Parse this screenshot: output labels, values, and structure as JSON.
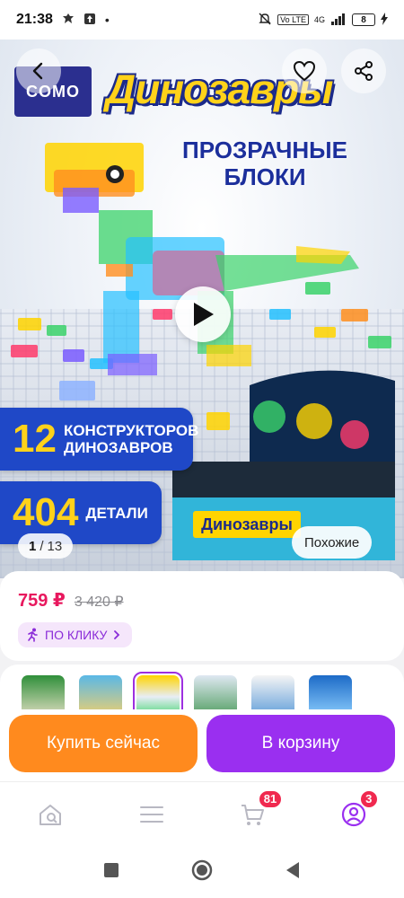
{
  "status_bar": {
    "time": "21:38",
    "network": "4G",
    "volte": "Vo LTE",
    "battery": "8"
  },
  "hero": {
    "brand_logo": "COMO",
    "title": "Динозавры",
    "subtitle_line1": "ПРОЗРАЧНЫЕ",
    "subtitle_line2": "БЛОКИ",
    "badge1_number": "12",
    "badge1_text_line1": "КОНСТРУКТОРОВ",
    "badge1_text_line2": "ДИНОЗАВРОВ",
    "badge2_number": "404",
    "badge2_text": "ДЕТАЛИ",
    "image_counter_current": "1",
    "image_counter_separator": "/",
    "image_counter_total": "13",
    "similar_label": "Похожие"
  },
  "product": {
    "price": "759 ₽",
    "old_price": "3 420 ₽",
    "promo_label": "ПО КЛИКУ"
  },
  "thumbnails": {
    "count_visible": 6,
    "active_index": 2
  },
  "actions": {
    "buy_now": "Купить сейчас",
    "add_to_cart": "В корзину"
  },
  "bottom_nav": {
    "cart_badge": "81",
    "profile_badge": "3"
  },
  "colors": {
    "price": "#e8185e",
    "buy_button": "#ff8a1e",
    "cart_button": "#9a2ff0",
    "promo_bg": "#f5e6fb",
    "promo_text": "#8a2bd8",
    "badge": "#f0294f"
  },
  "icons": {
    "back": "chevron-left-icon",
    "favorite": "heart-icon",
    "share": "share-icon",
    "play": "play-icon",
    "home": "home-search-icon",
    "catalog": "menu-icon",
    "cart": "cart-icon",
    "profile": "profile-icon"
  }
}
